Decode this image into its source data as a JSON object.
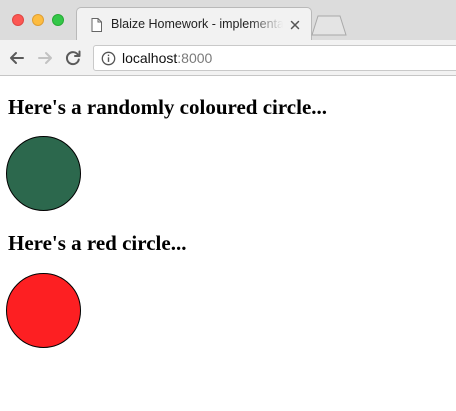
{
  "window": {
    "controls": [
      "close",
      "minimize",
      "zoom"
    ]
  },
  "tab": {
    "title": "Blaize Homework - implementation",
    "icon": "page-icon"
  },
  "toolbar": {
    "back_icon": "arrow-left-icon",
    "forward_icon": "arrow-right-icon",
    "reload_icon": "reload-icon"
  },
  "address_bar": {
    "host": "localhost",
    "port": ":8000",
    "info_icon": "info-icon"
  },
  "page": {
    "sections": [
      {
        "heading": "Here's a randomly coloured circle...",
        "circle_color": "#2c684d"
      },
      {
        "heading": "Here's a red circle...",
        "circle_color": "#fd1f22"
      }
    ]
  },
  "colors": {
    "tabstrip": "#dcdcdc",
    "toolbar": "#f2f2f2",
    "close": "#fc5753",
    "minimize": "#fdbc40",
    "zoom": "#33c748"
  }
}
